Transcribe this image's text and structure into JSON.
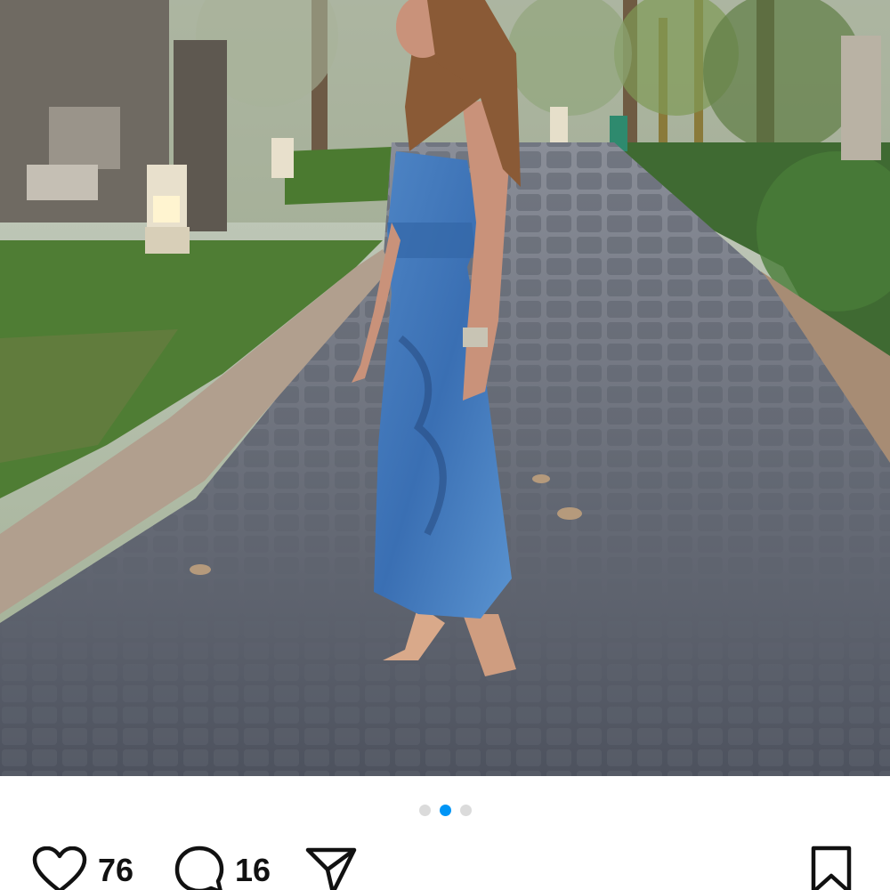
{
  "post": {
    "photo": {
      "subject": "woman-in-blue-dress-on-cobblestone-path",
      "carousel_index": 2,
      "carousel_count": 3
    },
    "likes": "76",
    "comments": "16",
    "icons": {
      "like": "heart-icon",
      "comment": "comment-icon",
      "share": "share-icon",
      "save": "bookmark-icon"
    },
    "colors": {
      "active_dot": "#0095f6",
      "inactive_dot": "#dbdbdb",
      "icon": "#111111"
    }
  }
}
